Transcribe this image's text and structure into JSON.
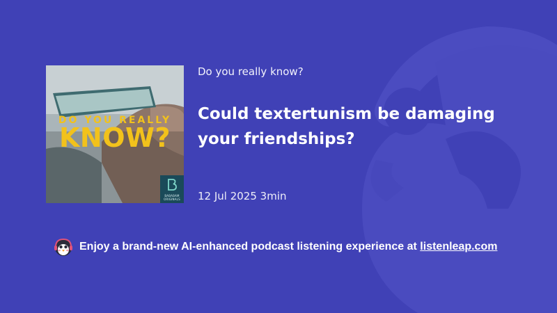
{
  "cover": {
    "line1": "DO YOU REALLY",
    "line2": "KNOW?",
    "badge_name": "BABABAM ORIGINALS"
  },
  "podcast": {
    "name": "Do you really know?"
  },
  "episode": {
    "title": "Could textertunism be damaging your friendships?",
    "meta": "12 Jul 2025 3min"
  },
  "banner": {
    "text": "Enjoy a brand-new AI-enhanced podcast listening experience at ",
    "link": "listenleap.com"
  },
  "colors": {
    "background": "#4041b6",
    "cover_text": "#f2c21b",
    "badge_bg": "#1a4a59"
  },
  "icons": {
    "background_logo": "listenleap-logo-watermark",
    "mascot": "penguin-headphones-icon",
    "badge": "bababam-b-icon"
  }
}
